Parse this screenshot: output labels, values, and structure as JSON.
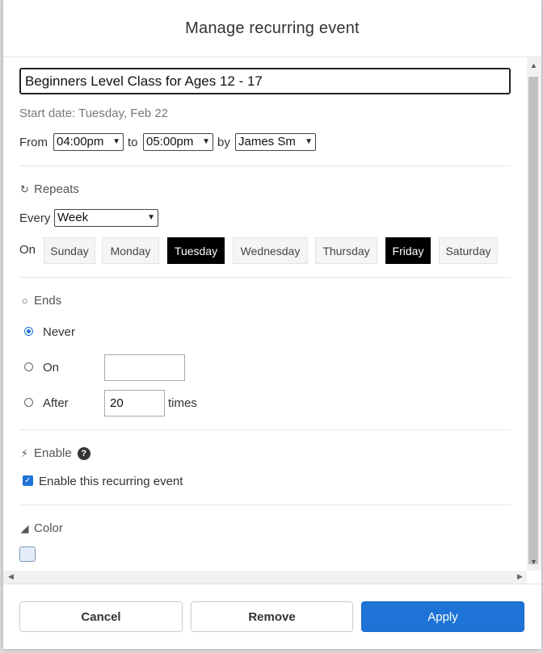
{
  "dialog": {
    "title": "Manage recurring event"
  },
  "event": {
    "title_value": "Beginners Level Class for Ages 12 - 17",
    "start_date": "Start date: Tuesday, Feb 22",
    "from_label": "From",
    "from_time": "04:00pm",
    "to_label": "to",
    "to_time": "05:00pm",
    "by_label": "by",
    "by_person": "James Sm"
  },
  "repeats": {
    "icon": "refresh-icon",
    "heading": "Repeats",
    "every_label": "Every",
    "every_value": "Week",
    "on_label": "On",
    "days": [
      {
        "label": "Sunday",
        "active": false
      },
      {
        "label": "Monday",
        "active": false
      },
      {
        "label": "Tuesday",
        "active": true
      },
      {
        "label": "Wednesday",
        "active": false
      },
      {
        "label": "Thursday",
        "active": false
      },
      {
        "label": "Friday",
        "active": true
      },
      {
        "label": "Saturday",
        "active": false
      }
    ]
  },
  "ends": {
    "icon": "circle-outline-icon",
    "heading": "Ends",
    "never_label": "Never",
    "on_label": "On",
    "on_value": "",
    "after_label": "After",
    "after_value": "20",
    "times_label": "times",
    "selected": "Never"
  },
  "enable": {
    "icon": "lightning-icon",
    "heading": "Enable",
    "help_glyph": "?",
    "checkbox_label": "Enable this recurring event",
    "checked": true
  },
  "color": {
    "icon": "paint-bucket-icon",
    "heading": "Color",
    "swatch_color": "#e4edf7"
  },
  "footer": {
    "cancel_label": "Cancel",
    "remove_label": "Remove",
    "apply_label": "Apply"
  },
  "colors": {
    "accent": "#1e73d7",
    "active_day": "#000000"
  }
}
